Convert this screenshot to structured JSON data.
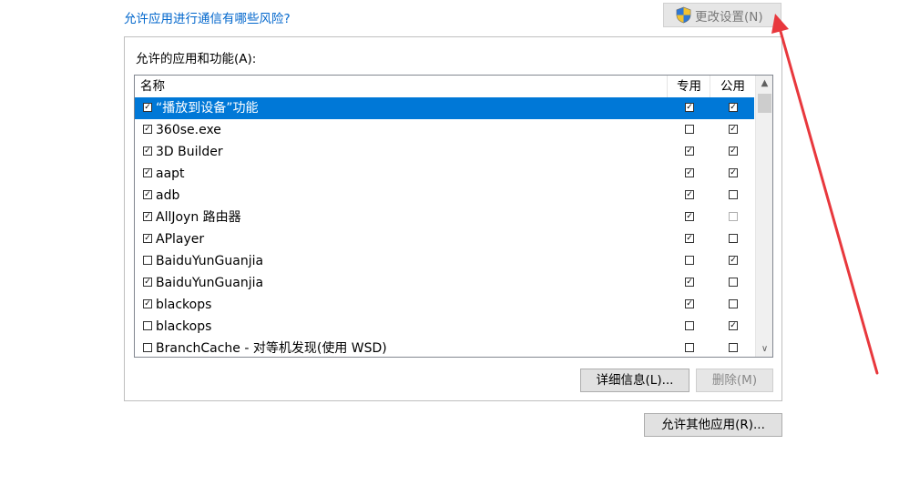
{
  "header": {
    "risk_link": "允许应用进行通信有哪些风险?",
    "change_settings_label": "更改设置(N)",
    "change_settings_icon": "uac-shield-icon"
  },
  "group": {
    "label": "允许的应用和功能(A):"
  },
  "list": {
    "columns": {
      "name": "名称",
      "private": "专用",
      "public": "公用"
    },
    "rows": [
      {
        "name": "“播放到设备”功能",
        "enabled": true,
        "private": true,
        "public": true,
        "selected": true
      },
      {
        "name": "360se.exe",
        "enabled": true,
        "private": false,
        "public": true
      },
      {
        "name": "3D Builder",
        "enabled": true,
        "private": true,
        "public": true
      },
      {
        "name": "aapt",
        "enabled": true,
        "private": true,
        "public": true
      },
      {
        "name": "adb",
        "enabled": true,
        "private": true,
        "public": false
      },
      {
        "name": "AllJoyn 路由器",
        "enabled": true,
        "private": true,
        "public": false,
        "public_dim": true
      },
      {
        "name": "APlayer",
        "enabled": true,
        "private": true,
        "public": false
      },
      {
        "name": "BaiduYunGuanjia",
        "enabled": false,
        "private": false,
        "public": true
      },
      {
        "name": "BaiduYunGuanjia",
        "enabled": true,
        "private": true,
        "public": false
      },
      {
        "name": "blackops",
        "enabled": true,
        "private": true,
        "public": false
      },
      {
        "name": "blackops",
        "enabled": false,
        "private": false,
        "public": true
      },
      {
        "name": "BranchCache - 对等机发现(使用 WSD)",
        "enabled": false,
        "private": false,
        "public": false
      }
    ]
  },
  "buttons": {
    "details": "详细信息(L)...",
    "delete": "删除(M)",
    "allow_other": "允许其他应用(R)..."
  },
  "colors": {
    "link": "#0066cc",
    "selection": "#0078d7",
    "annotation_arrow": "#e8383d"
  }
}
